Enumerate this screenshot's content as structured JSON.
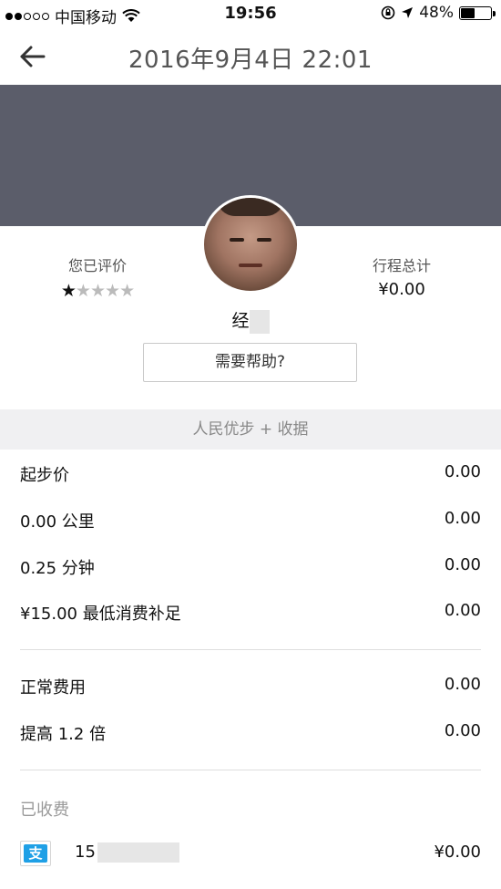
{
  "status_bar": {
    "carrier": "中国移动",
    "time": "19:56",
    "battery": "48%",
    "battery_level": 0.48
  },
  "nav": {
    "title": "2016年9月4日 22:01"
  },
  "summary": {
    "rating_label": "您已评价",
    "rating_value": 1,
    "rating_max": 5,
    "trip_total_label": "行程总计",
    "trip_total": "¥0.00",
    "driver_name": "经",
    "help_button": "需要帮助?"
  },
  "receipt": {
    "header": "人民优步 + 收据",
    "fare_items": [
      {
        "label": "起步价",
        "amount": "0.00"
      },
      {
        "label": "0.00 公里",
        "amount": "0.00"
      },
      {
        "label": "0.25 分钟",
        "amount": "0.00"
      },
      {
        "label": "¥15.00 最低消费补足",
        "amount": "0.00"
      }
    ],
    "adjustments": [
      {
        "label": "正常费用",
        "amount": "0.00"
      },
      {
        "label": "提高 1.2 倍",
        "amount": "0.00"
      }
    ],
    "paid_label": "已收费",
    "payment": {
      "icon_text": "支",
      "account": "15",
      "amount": "¥0.00"
    }
  }
}
